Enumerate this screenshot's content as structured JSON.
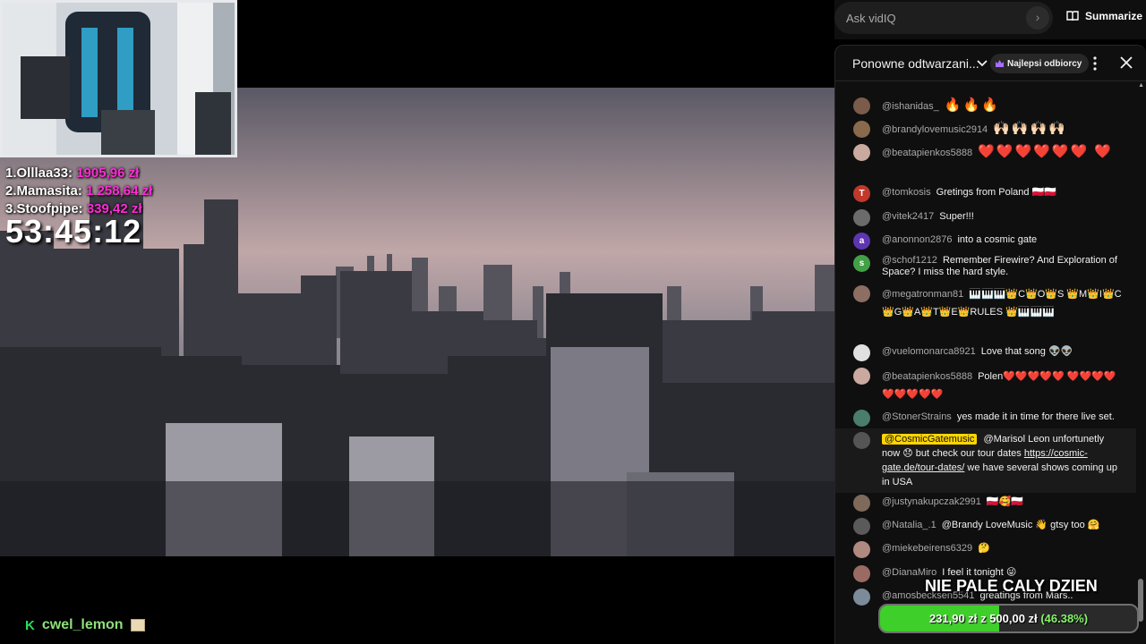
{
  "overlay": {
    "leaderboard": [
      {
        "rank_name": "1.Olllaa33:",
        "amount": "1905,96 zł"
      },
      {
        "rank_name": "2.Mamasita:",
        "amount": "1 258,64 zł"
      },
      {
        "rank_name": "3.Stoofpipe:",
        "amount": "339,42 zł"
      }
    ],
    "timer": "53:45:12",
    "streamer_badge": "K",
    "streamer_name": "cwel_lemon"
  },
  "vidiq": {
    "ask_placeholder": "Ask vidIQ",
    "go_icon": "chevron-right-icon",
    "summarize_label": "Summarize"
  },
  "chat": {
    "title": "Ponowne odtwarzani...",
    "top_fans_label": "Najlepsi odbiorcy",
    "messages": [
      {
        "author": "@ishanidas_",
        "text": "",
        "emojis": "🔥🔥🔥",
        "avatar_color": "#7b5b4a"
      },
      {
        "author": "@brandylovemusic2914",
        "text": "",
        "emojis": "🙌🏻🙌🏻🙌🏻🙌🏻",
        "avatar_color": "#8a6a4c"
      },
      {
        "author": "@beatapienkos5888",
        "text": "",
        "emojis": "❤️❤️❤️❤️❤️❤️ ❤️",
        "avatar_color": "#c9a9a0"
      },
      {
        "author": "@tomkosis",
        "text": "Gretings from Poland 🇵🇱🇵🇱",
        "emojis": "",
        "avatar_letter": "T",
        "avatar_color": "#c0392b"
      },
      {
        "author": "@vitek2417",
        "text": "Super!!!",
        "emojis": "",
        "avatar_color": "#6b6b6b"
      },
      {
        "author": "@anonnon2876",
        "text": "into a cosmic gate",
        "emojis": "",
        "avatar_letter": "a",
        "avatar_color": "#5e35b1"
      },
      {
        "author": "@schof1212",
        "text": "Remember Firewire? And Exploration of Space? I miss the hard style.",
        "emojis": "",
        "avatar_letter": "s",
        "avatar_color": "#43a047"
      },
      {
        "author": "@megatronman81",
        "text": "🎹🎹🎹👑C👑O👑S 👑M👑I👑C👑G👑A👑T👑E👑RULES 👑🎹🎹🎹",
        "emojis": "",
        "avatar_color": "#8d6e63"
      },
      {
        "author": "@vuelomonarca8921",
        "text": "Love that song 👽👽",
        "emojis": "",
        "avatar_color": "#e0e0e0"
      },
      {
        "author": "@beatapienkos5888",
        "text": "Polen❤️❤️❤️❤️❤️ ❤️❤️❤️❤️❤️❤️❤️❤️❤️",
        "emojis": "",
        "avatar_color": "#c9a9a0"
      },
      {
        "author": "@StonerStrains",
        "text": "yes made it in time for there live set.",
        "emojis": "",
        "avatar_color": "#4a7d6b"
      },
      {
        "author": "@CosmicGatemusic",
        "text": "@Marisol Leon unfortunetly now 😞 but check our tour dates",
        "link": "https://cosmic-gate.de/tour-dates/",
        "text_after": "we have several shows coming up in USA",
        "avatar_color": "#555"
      },
      {
        "author": "@justynakupczak2991",
        "text": "🇵🇱🥰🇵🇱",
        "emojis": "",
        "avatar_color": "#7d6a5a"
      },
      {
        "author": "@Natalia_.1",
        "text": "@Brandy LoveMusic 👋 gtsy too 🤗",
        "emojis": "",
        "avatar_color": "#5a5a5a"
      },
      {
        "author": "@miekebeirens6329",
        "text": "🤔",
        "emojis": "",
        "avatar_color": "#b08a80"
      },
      {
        "author": "@DianaMiro",
        "text": "I feel it tonight 😜",
        "emojis": "",
        "avatar_color": "#9a6b63"
      },
      {
        "author": "@amosbecksen5541",
        "text": "greatings from Mars..",
        "emojis": "",
        "avatar_color": "#7b8b9a"
      }
    ]
  },
  "goal": {
    "title": "NIE PALE CALY DZIEN",
    "current": "231,90 zł",
    "separator": "z",
    "target": "500,00 zł",
    "percent_label": "(46.38%)",
    "progress": 0.4638,
    "fill_color": "#3fcf2a"
  }
}
